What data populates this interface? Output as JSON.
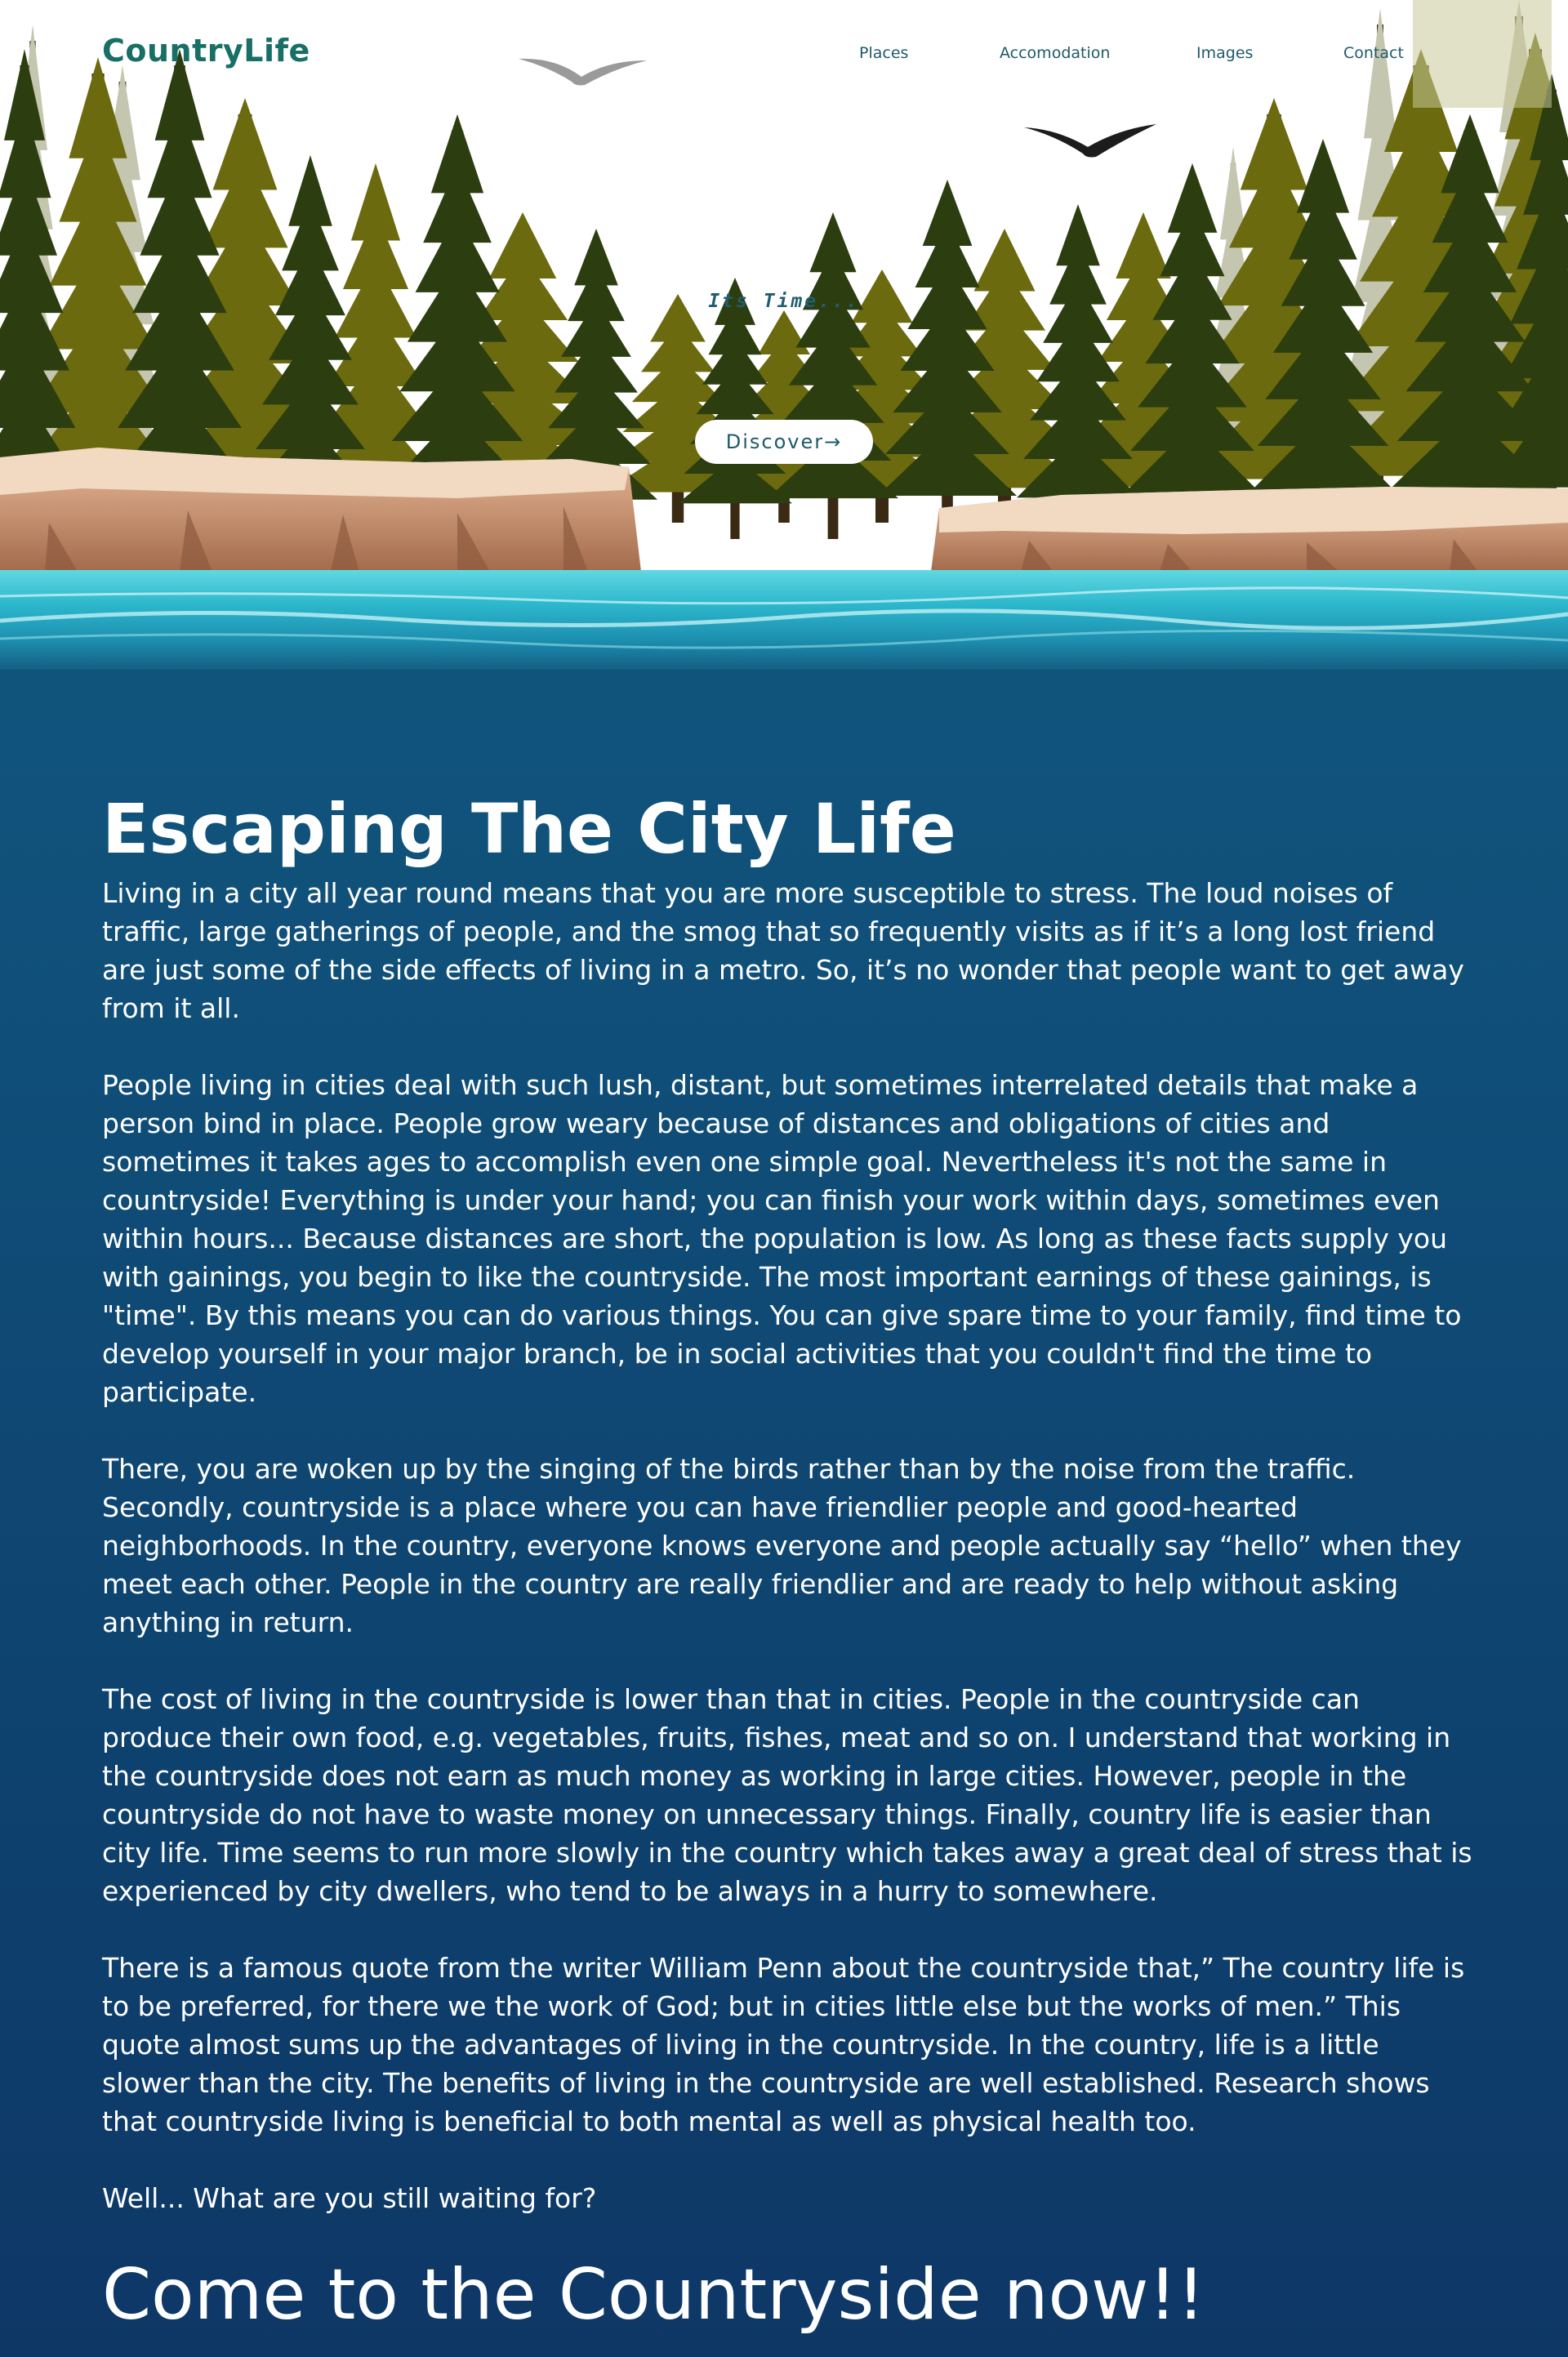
{
  "nav": {
    "logo": "CountryLife",
    "links": [
      "Places",
      "Accomodation",
      "Images",
      "Contact"
    ]
  },
  "hero": {
    "tagline": "Its Time...",
    "discover_label": "Discover→"
  },
  "article": {
    "heading": "Escaping The City Life",
    "paragraphs": [
      "Living in a city all year round means that you are more susceptible to stress. The loud noises of traffic, large gatherings of people, and the smog that so frequently visits as if it’s a long lost friend are just some of the side effects of living in a metro. So, it’s no wonder that people want to get away from it all.",
      "People living in cities deal with such lush, distant, but sometimes interrelated details that make a person bind in place. People grow weary because of distances and obligations of cities and sometimes it takes ages to accomplish even one simple goal. Nevertheless it's not the same in countryside! Everything is under your hand; you can finish your work within days, sometimes even within hours... Because distances are short, the population is low. As long as these facts supply you with gainings, you begin to like the countryside. The most important earnings of these gainings, is \"time\". By this means you can do various things. You can give spare time to your family, find time to develop yourself in your major branch, be in social activities that you couldn't find the time to participate.",
      "There, you are woken up by the singing of the birds rather than by the noise from the traffic. Secondly, countryside is a place where you can have friendlier people and good-hearted neighborhoods. In the country, everyone knows everyone and people actually say “hello” when they meet each other. People in the country are really friendlier and are ready to help without asking anything in return.",
      "The cost of living in the countryside is lower than that in cities. People in the countryside can produce their own food, e.g. vegetables, fruits, fishes, meat and so on. I understand that working in the countryside does not earn as much money as working in large cities. However, people in the countryside do not have to waste money on unnecessary things. Finally, country life is easier than city life. Time seems to run more slowly in the country which takes away a great deal of stress that is experienced by city dwellers, who tend to be always in a hurry to somewhere.",
      "There is a famous quote from the writer William Penn about the countryside that,” The country life is to be preferred, for there we the work of God; but in cities little else but the works of men.” This quote almost sums up the advantages of living in the countryside. In the country, life is a little slower than the city. The benefits of living in the countryside are well established. Research shows that countryside living is beneficial to both mental as well as physical health too.",
      "Well... What are you still waiting for?"
    ],
    "closing": "Come to the Countryside now!!"
  },
  "colors": {
    "background_top": "#135f84",
    "background_bottom": "#0e3766",
    "logo": "#176f65",
    "tree_olive": "#6b6a0e",
    "tree_dark": "#2c3d10",
    "cliff": "#c8906e",
    "water": "#3fc6d6"
  },
  "icons": [
    "bird-icon",
    "pine-tree-icon",
    "arrow-right-icon"
  ]
}
